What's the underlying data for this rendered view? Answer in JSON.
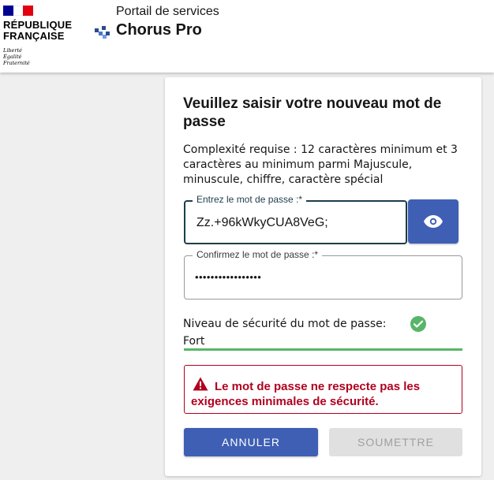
{
  "header": {
    "republic_line1": "RÉPUBLIQUE",
    "republic_line2": "FRANÇAISE",
    "motto_line1": "Liberté",
    "motto_line2": "Égalité",
    "motto_line3": "Fraternité",
    "portal_subtitle": "Portail de services",
    "portal_name": "Chorus Pro"
  },
  "form": {
    "title": "Veuillez saisir votre nouveau mot de passe",
    "requirement": "Complexité requise : 12 caractères minimum et 3 caractères au minimum parmi Majuscule, minuscule, chiffre, caractère spécial",
    "new_password": {
      "label": "Entrez le mot de passe :*",
      "value": "Zz.+96kWkyCUA8VeG;"
    },
    "show_password_icon": "eye-icon",
    "confirm_password": {
      "label": "Confirmez le mot de passe :*",
      "value": "•••••••••••••••••"
    },
    "strength_label": "Niveau de sécurité du mot de passe:",
    "strength_value": "Fort",
    "strength_fraction": 1.0,
    "error_message": "Le mot de passe ne respecte pas les exigences minimales de sécurité.",
    "cancel_label": "ANNULER",
    "submit_label": "SOUMETTRE"
  },
  "colors": {
    "primary_blue": "#3f5fb5",
    "success_green": "#57b667",
    "error_red": "#b0001f",
    "flag_blue": "#000091",
    "flag_red": "#e1000f"
  }
}
